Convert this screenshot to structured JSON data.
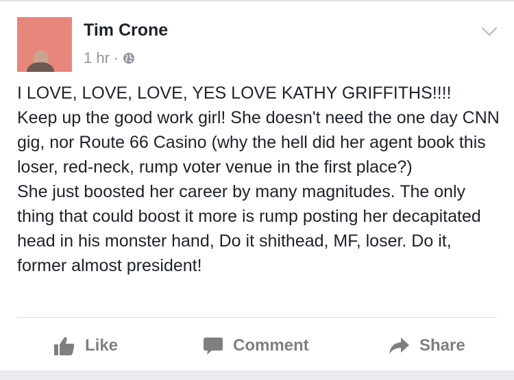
{
  "post": {
    "author": "Tim Crone",
    "timestamp": "1 hr",
    "separator": "·",
    "privacy_icon": "globe-icon",
    "menu_icon": "chevron-down-icon",
    "text": "I LOVE, LOVE, LOVE, YES LOVE KATHY GRIFFITHS!!!!\nKeep up the good work girl! She doesn't need the one day CNN gig, nor Route 66 Casino (why the hell did her agent book this loser, red-neck, rump voter venue in the first place?)\nShe just boosted her career by many magnitudes. The only thing that could boost it more is rump posting her decapitated head in his monster hand, Do it shithead, MF, loser. Do it, former almost president!"
  },
  "actions": {
    "like": "Like",
    "comment": "Comment",
    "share": "Share"
  },
  "colors": {
    "text": "#1d2129",
    "meta": "#90949c",
    "action": "#7f7f7f",
    "divider": "#dddfe2",
    "avatar_bg": "#e7867a"
  }
}
